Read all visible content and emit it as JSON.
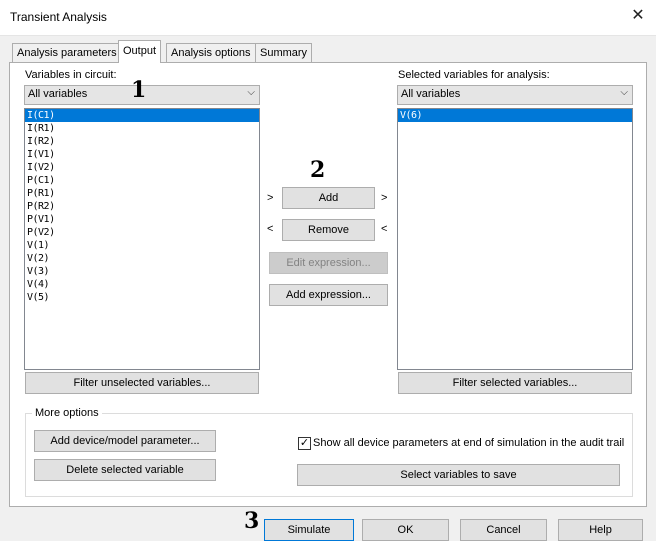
{
  "window": {
    "title": "Transient Analysis",
    "close_glyph": "✕"
  },
  "tabs": [
    {
      "label": "Analysis parameters"
    },
    {
      "label": "Output"
    },
    {
      "label": "Analysis options"
    },
    {
      "label": "Summary"
    }
  ],
  "left": {
    "label": "Variables in circuit:",
    "filter_value": "All variables",
    "items": [
      "I(C1)",
      "I(R1)",
      "I(R2)",
      "I(V1)",
      "I(V2)",
      "P(C1)",
      "P(R1)",
      "P(R2)",
      "P(V1)",
      "P(V2)",
      "V(1)",
      "V(2)",
      "V(3)",
      "V(4)",
      "V(5)"
    ],
    "filter_button": "Filter unselected variables..."
  },
  "right": {
    "label": "Selected variables for analysis:",
    "filter_value": "All variables",
    "items": [
      "V(6)"
    ],
    "filter_button": "Filter selected variables..."
  },
  "middle": {
    "add": "Add",
    "remove": "Remove",
    "edit_expression": "Edit expression...",
    "add_expression": "Add expression...",
    "arrow_right": ">",
    "arrow_left": "<"
  },
  "more_options": {
    "title": "More options",
    "add_device_param": "Add device/model parameter...",
    "delete_selected": "Delete selected variable",
    "show_params_label": "Show all device parameters at end of simulation in the audit trail",
    "show_params_checked": true,
    "select_vars_save": "Select variables to save"
  },
  "footer": {
    "simulate": "Simulate",
    "ok": "OK",
    "cancel": "Cancel",
    "help": "Help"
  },
  "annotations": {
    "n1": "1",
    "n2": "2",
    "n3": "3"
  },
  "colors": {
    "selection": "#0078d7",
    "focus_border": "#0078d7"
  }
}
